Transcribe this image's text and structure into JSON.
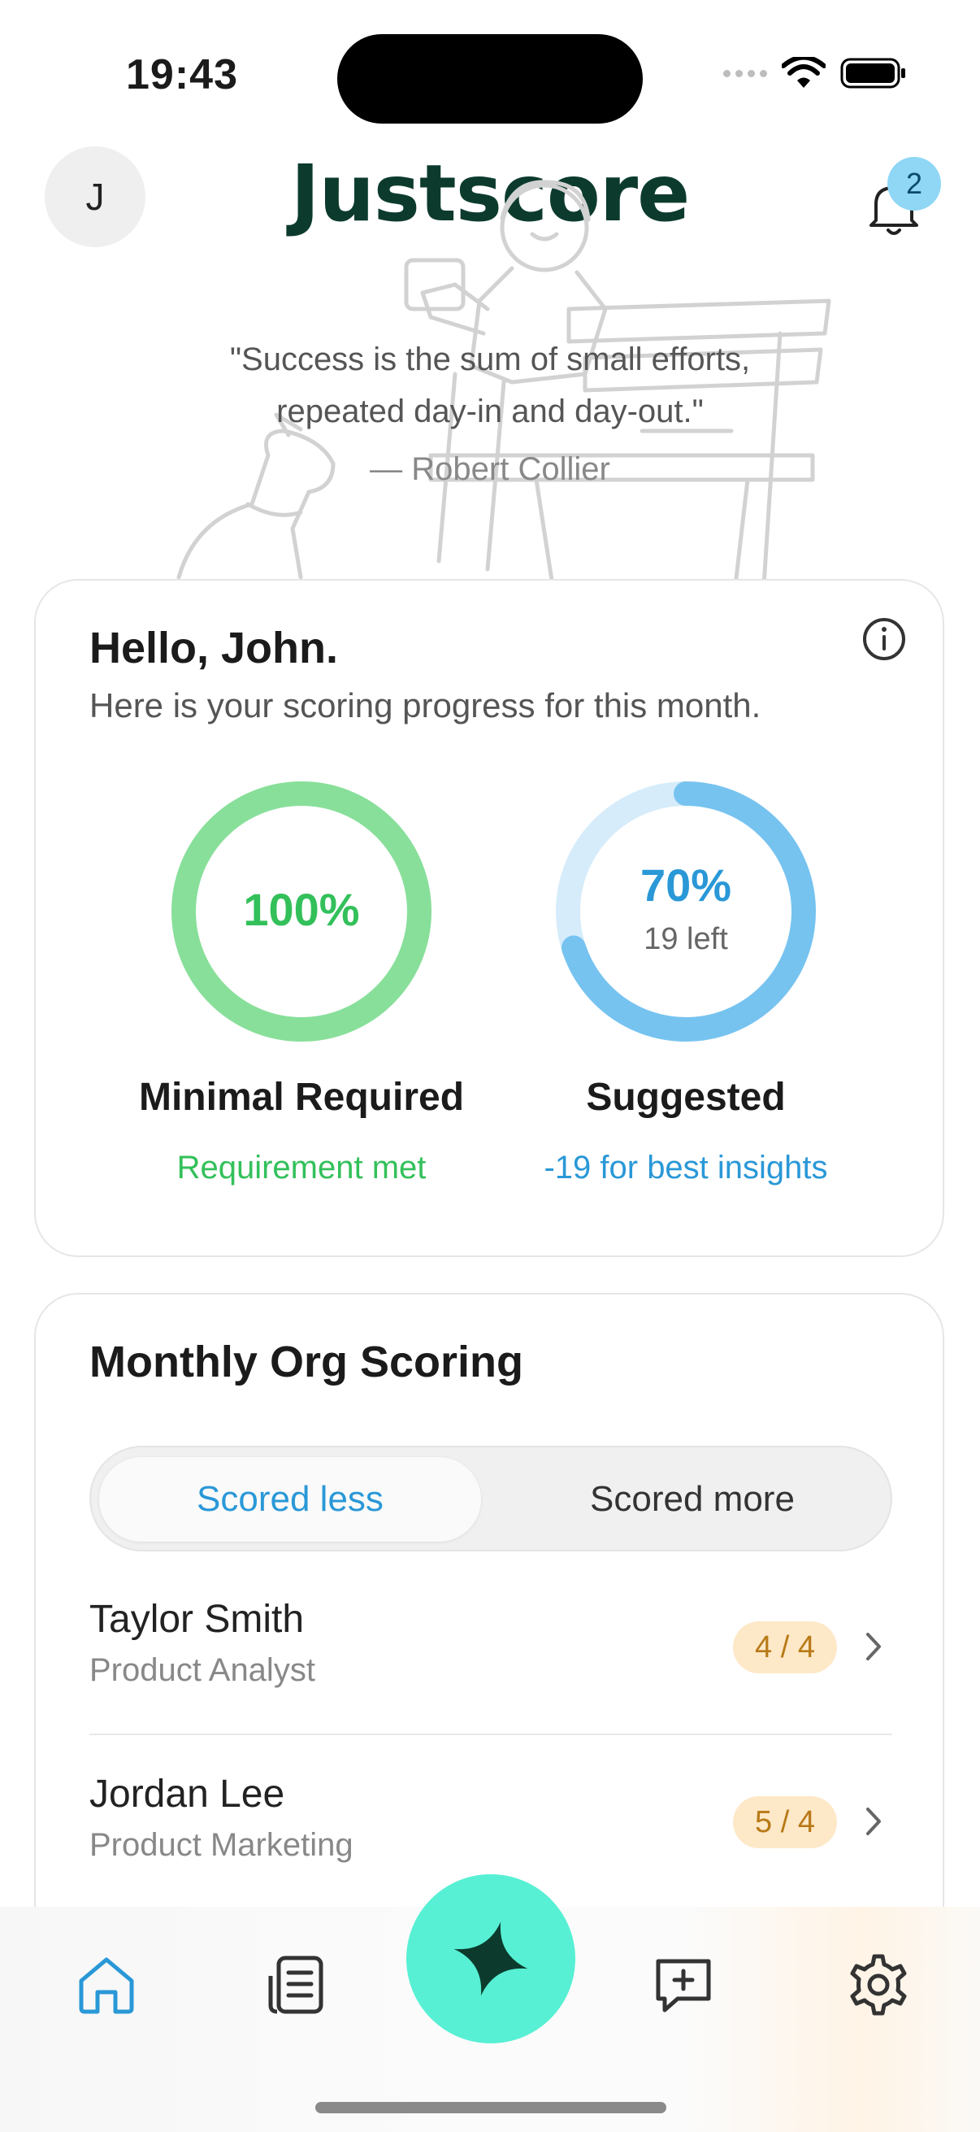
{
  "status": {
    "time": "19:43"
  },
  "header": {
    "avatar_initial": "J",
    "logo": "Justscore",
    "notification_count": "2"
  },
  "quote": {
    "line1": "\"Success is the sum of small efforts,",
    "line2": "repeated day-in and day-out.\"",
    "author": "— Robert Collier"
  },
  "progress": {
    "greeting": "Hello, John.",
    "subtitle": "Here is your scoring progress for this month.",
    "minimal": {
      "percent": "100%",
      "value": 1.0,
      "title": "Minimal Required",
      "note": "Requirement met",
      "color": "#33c05a"
    },
    "suggested": {
      "percent": "70%",
      "value": 0.7,
      "left": "19 left",
      "title": "Suggested",
      "note": "-19 for best insights",
      "color": "#2a98d7"
    }
  },
  "org": {
    "title": "Monthly Org Scoring",
    "tabs": [
      "Scored less",
      "Scored more"
    ],
    "active_tab": "Scored less",
    "rows": [
      {
        "name": "Taylor Smith",
        "role": "Product Analyst",
        "score": "4 / 4"
      },
      {
        "name": "Jordan Lee",
        "role": "Product Marketing",
        "score": "5 / 4"
      }
    ]
  },
  "nav": {
    "items": [
      "home-icon",
      "document-icon",
      "sparkle-icon",
      "chat-plus-icon",
      "gear-icon"
    ],
    "active": "home-icon",
    "accent": "#2a98d7",
    "fab_color": "#57f0d4"
  }
}
